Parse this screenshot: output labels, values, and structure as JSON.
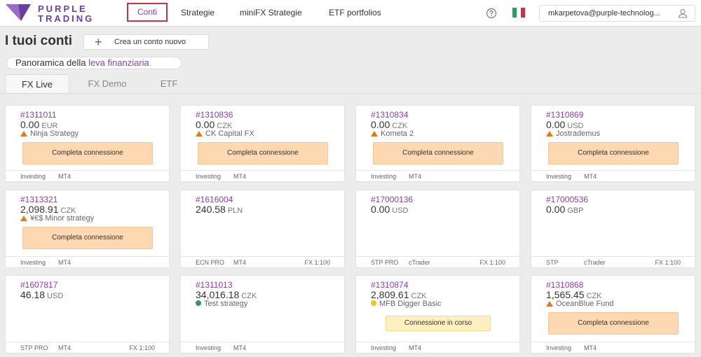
{
  "brand": {
    "line1": "PURPLE",
    "line2": "TRADING"
  },
  "nav": {
    "conti": "Conti",
    "strategie": "Strategie",
    "minifx": "miniFX Strategie",
    "etf": "ETF portfolios"
  },
  "user": {
    "email": "mkarpetova@purple-technolog..."
  },
  "page": {
    "title": "I tuoi conti",
    "create_label": "Crea un conto nuovo",
    "leva_prefix": "Panoramica della ",
    "leva_accent": "leva finanziaria"
  },
  "tabs": [
    "FX Live",
    "FX Demo",
    "ETF"
  ],
  "accounts": [
    {
      "num": "#1311011",
      "balance": "0.00",
      "currency": "EUR",
      "strategy": "Ninja Strategy",
      "status": "Completa connessione",
      "type": "Investing",
      "platform": "MT4",
      "leverage": ""
    },
    {
      "num": "#1310836",
      "balance": "0.00",
      "currency": "CZK",
      "strategy": "CK Capital FX",
      "status": "Completa connessione",
      "type": "Investing",
      "platform": "MT4",
      "leverage": ""
    },
    {
      "num": "#1310834",
      "balance": "0.00",
      "currency": "CZK",
      "strategy": "Kometa 2",
      "status": "Completa connessione",
      "type": "Investing",
      "platform": "MT4",
      "leverage": ""
    },
    {
      "num": "#1310869",
      "balance": "0.00",
      "currency": "USD",
      "strategy": "Jostrademus",
      "status": "Completa connessione",
      "type": "Investing",
      "platform": "MT4",
      "leverage": ""
    },
    {
      "num": "#1313321",
      "balance": "2,098.91",
      "currency": "CZK",
      "strategy": "¥€$ Minor strategy",
      "status": "Completa connessione",
      "type": "Investing",
      "platform": "MT4",
      "leverage": ""
    },
    {
      "num": "#1616004",
      "balance": "240.58",
      "currency": "PLN",
      "strategy": "",
      "status": "",
      "type": "ECN PRO",
      "platform": "MT4",
      "leverage": "FX 1:100"
    },
    {
      "num": "#17000136",
      "balance": "0.00",
      "currency": "USD",
      "strategy": "",
      "status": "",
      "type": "STP PRO",
      "platform": "cTrader",
      "leverage": "FX 1:100"
    },
    {
      "num": "#17000536",
      "balance": "0.00",
      "currency": "GBP",
      "strategy": "",
      "status": "",
      "type": "STP",
      "platform": "cTrader",
      "leverage": "FX 1:100"
    },
    {
      "num": "#1607817",
      "balance": "46.18",
      "currency": "USD",
      "strategy": "",
      "status": "",
      "type": "STP PRO",
      "platform": "MT4",
      "leverage": "FX 1:100"
    },
    {
      "num": "#1311013",
      "balance": "34,016.18",
      "currency": "CZK",
      "strategy": "Test strategy",
      "status": "",
      "type": "Investing",
      "platform": "MT4",
      "leverage": ""
    },
    {
      "num": "#1310874",
      "balance": "2,809.61",
      "currency": "CZK",
      "strategy": "MFB Digger Basic",
      "status": "Connessione in corso",
      "type": "Investing",
      "platform": "MT4",
      "leverage": ""
    },
    {
      "num": "#1310868",
      "balance": "1,565.45",
      "currency": "CZK",
      "strategy": "OceanBlue Fund",
      "status": "Completa connessione",
      "type": "Investing",
      "platform": "MT4",
      "leverage": ""
    }
  ],
  "colors": {
    "accent": "#8a3fb0",
    "warning_triangle": "#e07b17",
    "dot_green": "#2e9c5f",
    "dot_yellow": "#f0c419",
    "connect_bg": "#fdd8b0"
  }
}
